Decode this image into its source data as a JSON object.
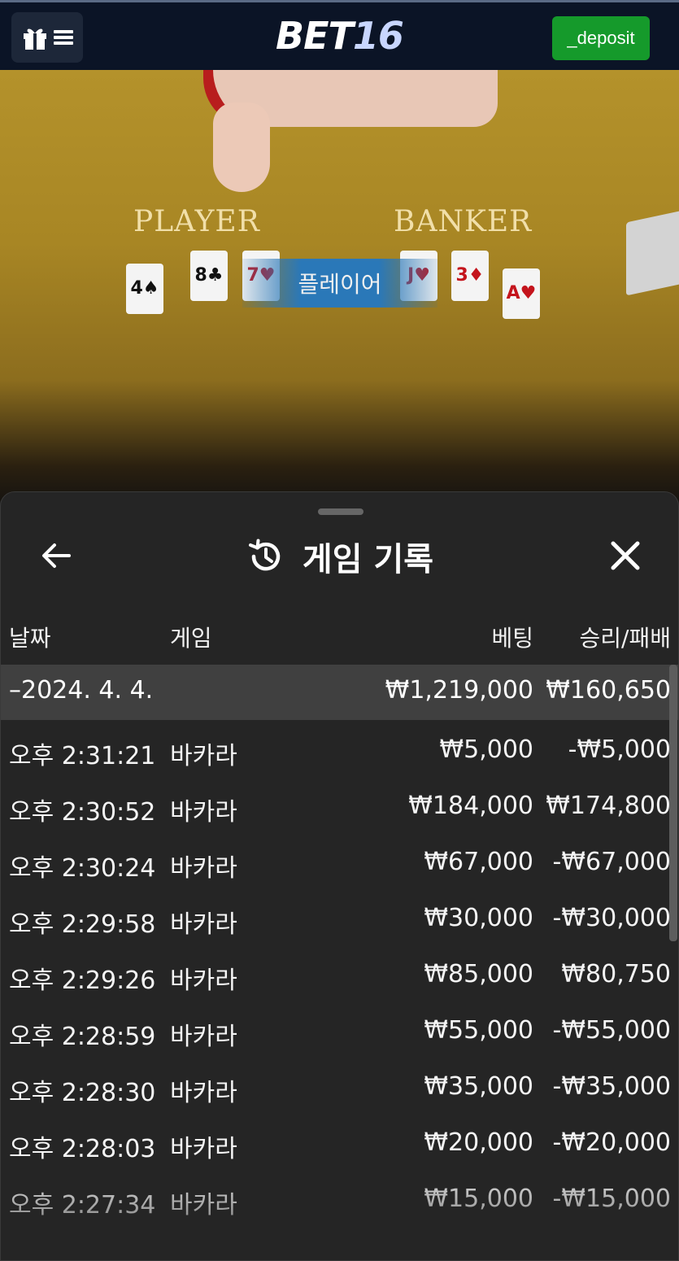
{
  "header": {
    "logo_text": "BET",
    "logo_number": "16",
    "deposit_label": "_deposit"
  },
  "table": {
    "player_label": "PLAYER",
    "banker_label": "BANKER",
    "result_banner": "플레이어",
    "player_cards": [
      "4♠",
      "8♣",
      "7♥"
    ],
    "banker_cards": [
      "J♥",
      "3♦",
      "A♥"
    ]
  },
  "sheet": {
    "title": "게임 기록",
    "columns": {
      "date": "날짜",
      "game": "게임",
      "bet": "베팅",
      "result": "승리/패배"
    },
    "summary": {
      "date": "–2024. 4. 4.",
      "bet": "₩1,219,000",
      "result": "₩160,650"
    },
    "rows": [
      {
        "time": "오후 2:31:21",
        "game": "바카라",
        "bet": "₩5,000",
        "result": "-₩5,000"
      },
      {
        "time": "오후 2:30:52",
        "game": "바카라",
        "bet": "₩184,000",
        "result": "₩174,800"
      },
      {
        "time": "오후 2:30:24",
        "game": "바카라",
        "bet": "₩67,000",
        "result": "-₩67,000"
      },
      {
        "time": "오후 2:29:58",
        "game": "바카라",
        "bet": "₩30,000",
        "result": "-₩30,000"
      },
      {
        "time": "오후 2:29:26",
        "game": "바카라",
        "bet": "₩85,000",
        "result": "₩80,750"
      },
      {
        "time": "오후 2:28:59",
        "game": "바카라",
        "bet": "₩55,000",
        "result": "-₩55,000"
      },
      {
        "time": "오후 2:28:30",
        "game": "바카라",
        "bet": "₩35,000",
        "result": "-₩35,000"
      },
      {
        "time": "오후 2:28:03",
        "game": "바카라",
        "bet": "₩20,000",
        "result": "-₩20,000"
      },
      {
        "time": "오후 2:27:34",
        "game": "바카라",
        "bet": "₩15,000",
        "result": "-₩15,000"
      }
    ]
  },
  "icons": {
    "menu": "gift-menu-icon",
    "back": "arrow-left-icon",
    "history": "history-icon",
    "close": "close-icon"
  },
  "colors": {
    "topbar": "#0b1426",
    "deposit": "#159a2b",
    "sheet": "#252525",
    "summary_row": "#404040"
  }
}
